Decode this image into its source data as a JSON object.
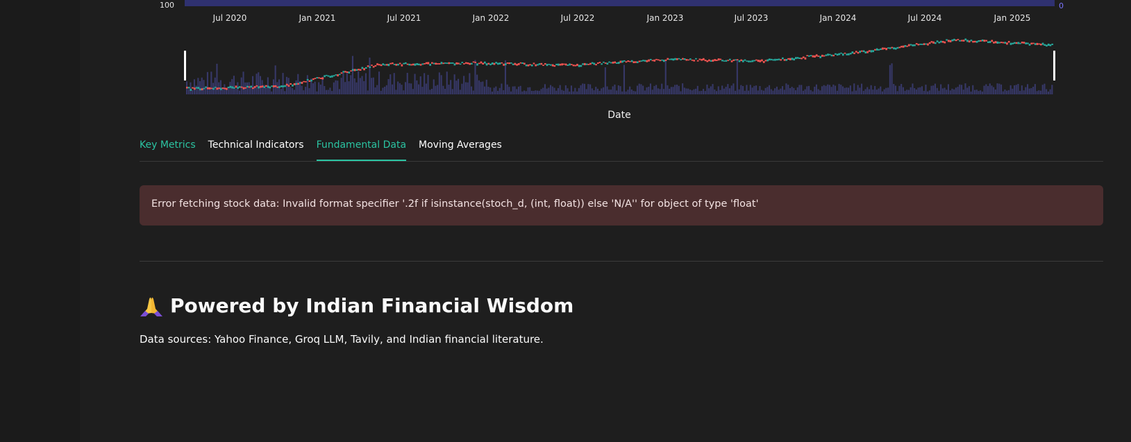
{
  "chart": {
    "y_left_bottom_tick": "100",
    "y_right_bottom_tick": "0",
    "x_ticks": [
      "Jul 2020",
      "Jan 2021",
      "Jul 2021",
      "Jan 2022",
      "Jul 2022",
      "Jan 2023",
      "Jul 2023",
      "Jan 2024",
      "Jul 2024",
      "Jan 2025"
    ],
    "x_title": "Date",
    "colors": {
      "up": "#26a69a",
      "down": "#ef5350",
      "volume": "#3d3f7a",
      "handle": "#ffffff"
    }
  },
  "chart_data": {
    "type": "line",
    "xlabel": "Date",
    "x": [
      "Jul 2020",
      "Jan 2021",
      "Jul 2021",
      "Jan 2022",
      "Jul 2022",
      "Jan 2023",
      "Jul 2023",
      "Jan 2024",
      "Jul 2024",
      "Jan 2025"
    ],
    "series": [
      {
        "values": [
          5,
          8,
          38,
          40,
          37,
          45,
          43,
          55,
          72,
          65
        ]
      }
    ]
  },
  "tabs": [
    {
      "label": "Key Metrics"
    },
    {
      "label": "Technical Indicators"
    },
    {
      "label": "Fundamental Data"
    },
    {
      "label": "Moving Averages"
    }
  ],
  "error": {
    "message": "Error fetching stock data: Invalid format specifier '.2f if isinstance(stoch_d, (int, float)) else 'N/A'' for object of type 'float'"
  },
  "footer": {
    "title": "Powered by Indian Financial Wisdom",
    "sources": "Data sources: Yahoo Finance, Groq LLM, Tavily, and Indian financial literature.",
    "title_icon": "folded-hands-icon"
  }
}
